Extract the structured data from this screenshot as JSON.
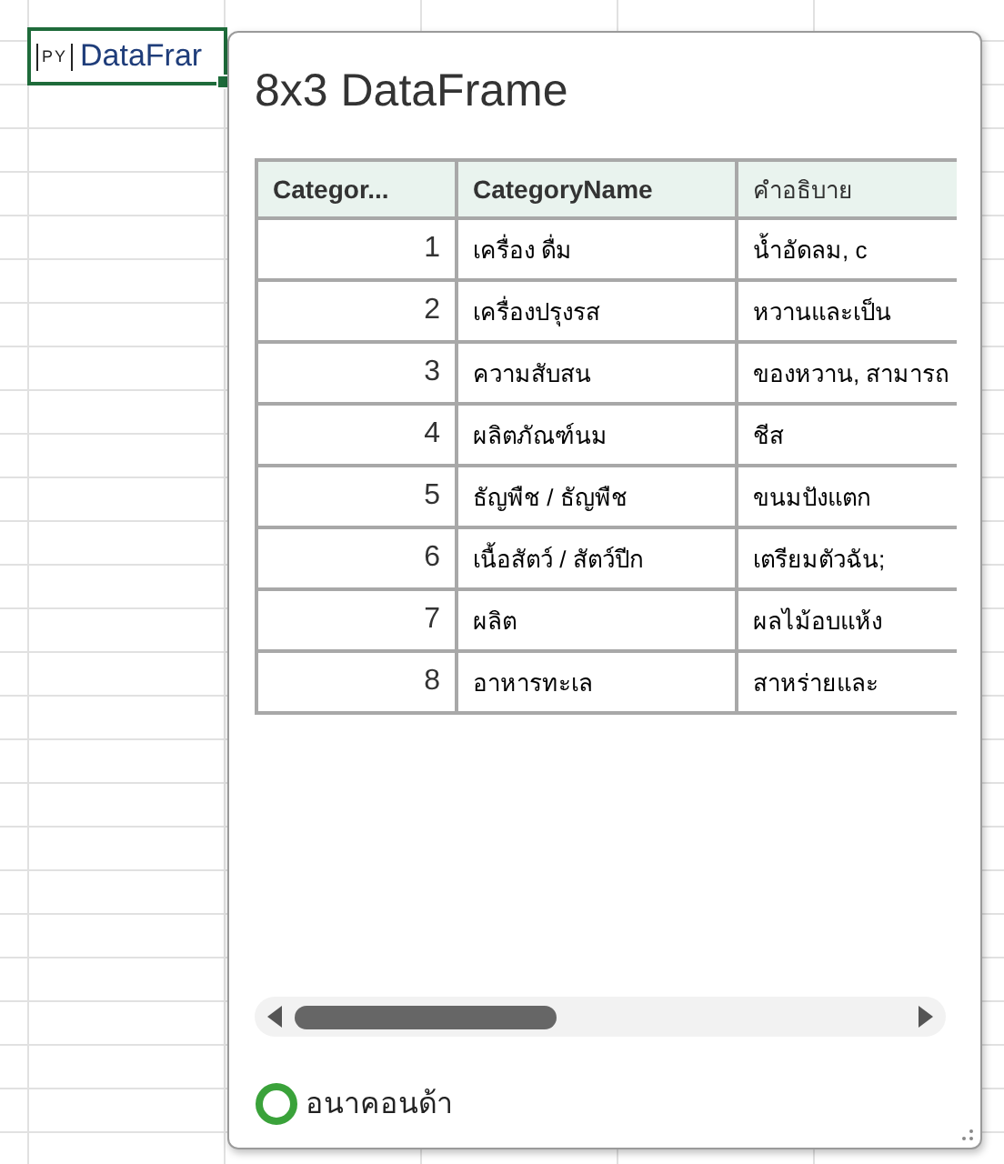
{
  "cell": {
    "badge": "PY",
    "value": "DataFrar",
    "selected": true
  },
  "card": {
    "title": "8x3 DataFrame",
    "table": {
      "columns": [
        "Categor...",
        "CategoryName",
        "คำอธิบาย"
      ],
      "rows": [
        [
          "1",
          "เครื่อง ดื่ม",
          "น้ำอัดลม, c"
        ],
        [
          "2",
          "เครื่องปรุงรส",
          "หวานและเป็น"
        ],
        [
          "3",
          "ความสับสน",
          "ของหวาน, สามารถ"
        ],
        [
          "4",
          "ผลิตภัณฑ์นม",
          "ชีส"
        ],
        [
          "5",
          "ธัญพืช / ธัญพืช",
          "ขนมปังแตก"
        ],
        [
          "6",
          "เนื้อสัตว์ / สัตว์ปีก",
          "เตรียมตัวฉัน;"
        ],
        [
          "7",
          "ผลิต",
          "ผลไม้อบแห้ง"
        ],
        [
          "8",
          "อาหารทะเล",
          "สาหร่ายและ"
        ]
      ]
    },
    "footer": {
      "label": "อนาคอนด้า"
    }
  }
}
